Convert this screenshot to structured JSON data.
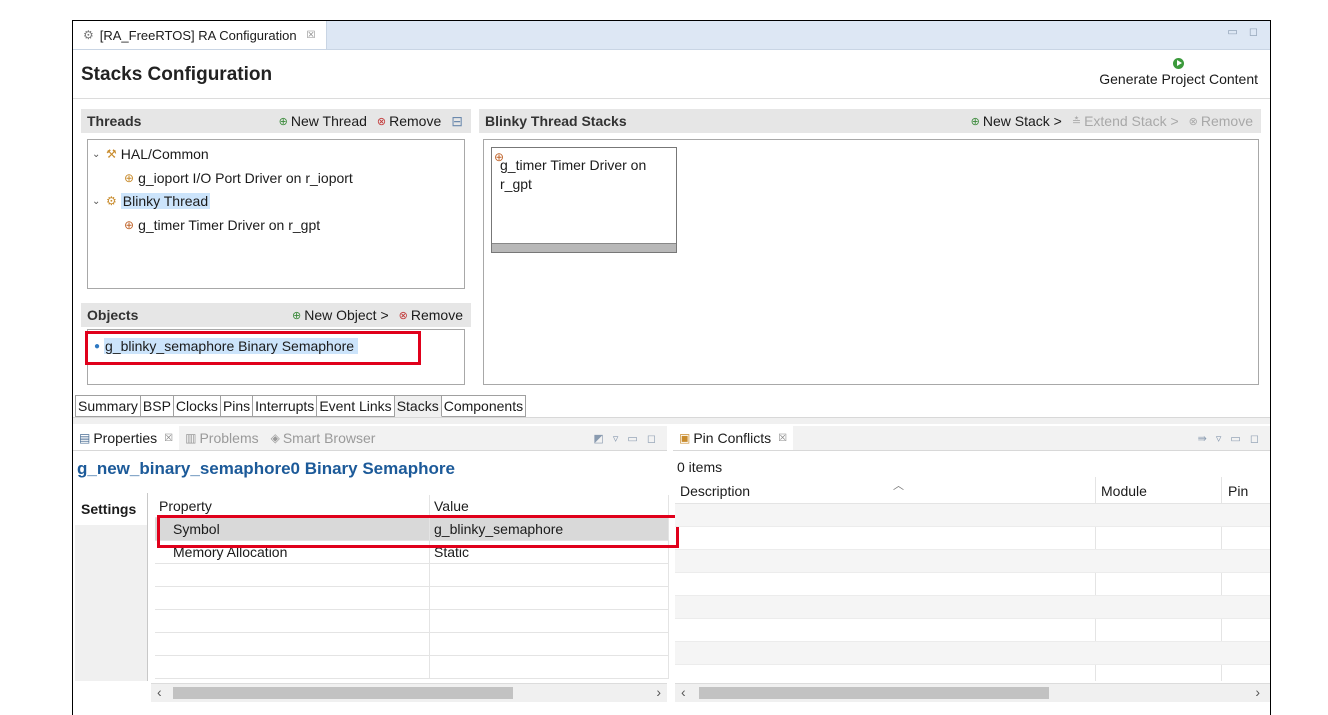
{
  "editor_tab": {
    "label": "[RA_FreeRTOS] RA Configuration",
    "close": "☒"
  },
  "header": {
    "title": "Stacks Configuration",
    "generate_label": "Generate Project Content"
  },
  "threads": {
    "title": "Threads",
    "new_label": "New Thread",
    "remove_label": "Remove",
    "items": [
      {
        "label": "HAL/Common"
      },
      {
        "label": "g_ioport I/O Port Driver on r_ioport"
      },
      {
        "label": "Blinky Thread"
      },
      {
        "label": "g_timer Timer Driver on r_gpt"
      }
    ]
  },
  "objects": {
    "title": "Objects",
    "new_label": "New Object >",
    "remove_label": "Remove",
    "items": [
      {
        "label": "g_blinky_semaphore Binary Semaphore"
      }
    ]
  },
  "stacks": {
    "title": "Blinky Thread Stacks",
    "new_label": "New Stack >",
    "extend_label": "Extend Stack >",
    "remove_label": "Remove",
    "block_label": "g_timer Timer Driver on r_gpt"
  },
  "config_tabs": [
    "Summary",
    "BSP",
    "Clocks",
    "Pins",
    "Interrupts",
    "Event Links",
    "Stacks",
    "Components"
  ],
  "config_active": "Stacks",
  "properties_view": {
    "tabs": [
      "Properties",
      "Problems",
      "Smart Browser"
    ],
    "title": "g_new_binary_semaphore0 Binary Semaphore",
    "settings_label": "Settings",
    "col_property": "Property",
    "col_value": "Value",
    "rows": [
      {
        "property": "Symbol",
        "value": "g_blinky_semaphore"
      },
      {
        "property": "Memory Allocation",
        "value": "Static"
      }
    ]
  },
  "pin_conflicts": {
    "tab": "Pin Conflicts",
    "count": "0 items",
    "columns": [
      "Description",
      "Module",
      "Pin"
    ]
  },
  "colors": {
    "highlight": "#e0001b",
    "title_blue": "#1c5a99",
    "tabbar": "#dde7f4"
  }
}
